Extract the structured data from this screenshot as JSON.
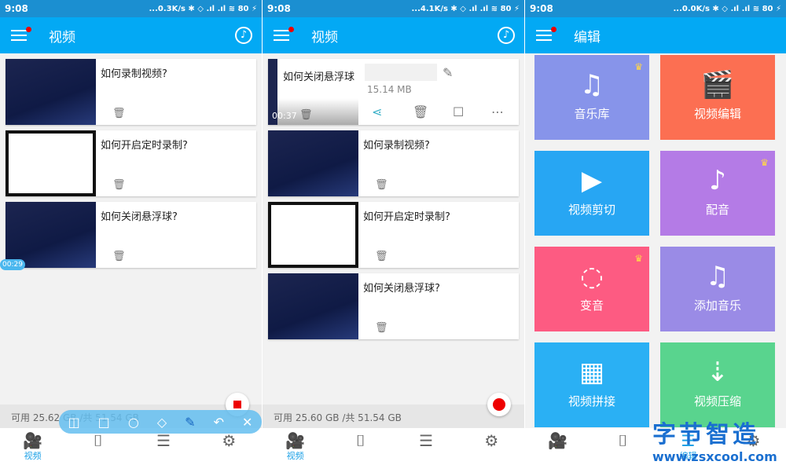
{
  "panels": [
    {
      "status": {
        "time": "9:08",
        "right": "...0.3K/s ✱ ◇ .ıl .ıl ≋ 80 ⚡"
      },
      "title": "视频",
      "cards": [
        {
          "title": "如何录制视频?"
        },
        {
          "title": "如何开启定时录制?"
        },
        {
          "title": "如何关闭悬浮球?"
        }
      ],
      "storage": "可用 25.62 GB /共 51.54 GB",
      "badge": "00:29"
    },
    {
      "status": {
        "time": "9:08",
        "right": "...4.1K/s ✱ ◇ .ıl .ıl ≋ 80 ⚡"
      },
      "title": "视频",
      "expanded": {
        "title": "如何关闭悬浮球",
        "duration": "00:37",
        "size": "15.14 MB"
      },
      "cards": [
        {
          "title": "如何录制视频?"
        },
        {
          "title": "如何开启定时录制?"
        },
        {
          "title": "如何关闭悬浮球?"
        }
      ],
      "storage": "可用 25.60 GB /共 51.54 GB"
    },
    {
      "status": {
        "time": "9:08",
        "right": "...0.0K/s ✱ ◇ .ıl .ıl ≋ 80 ⚡"
      },
      "title": "编辑",
      "tiles": [
        {
          "label": "音乐库",
          "icon": "♫",
          "color": "#8794ea",
          "crown": true
        },
        {
          "label": "视频编辑",
          "icon": "🎬",
          "color": "#fc6f52"
        },
        {
          "label": "视频剪切",
          "icon": "▶",
          "color": "#27a6f3"
        },
        {
          "label": "配音",
          "icon": "♪",
          "color": "#b47be6",
          "crown": true
        },
        {
          "label": "变音",
          "icon": "◌",
          "color": "#fd5b82",
          "crown": true
        },
        {
          "label": "添加音乐",
          "icon": "♫",
          "color": "#9a8be6"
        },
        {
          "label": "视频拼接",
          "icon": "▦",
          "color": "#2ab0f4"
        },
        {
          "label": "视频压缩",
          "icon": "⇣",
          "color": "#59d48e"
        }
      ]
    }
  ],
  "nav": {
    "video": "视频",
    "edit": "编辑"
  },
  "toolbar_icons": [
    "camera-icon",
    "square-icon",
    "circle-icon",
    "eraser-icon",
    "brush-icon",
    "undo-icon",
    "close-icon"
  ],
  "watermark": {
    "text": "字节智造",
    "url": "www.zsxcool.com"
  },
  "colors": {
    "appbar": "#03a9f4",
    "statusbar": "#1b8fd1",
    "accent": "#1da1e6",
    "record": "#e00000"
  }
}
